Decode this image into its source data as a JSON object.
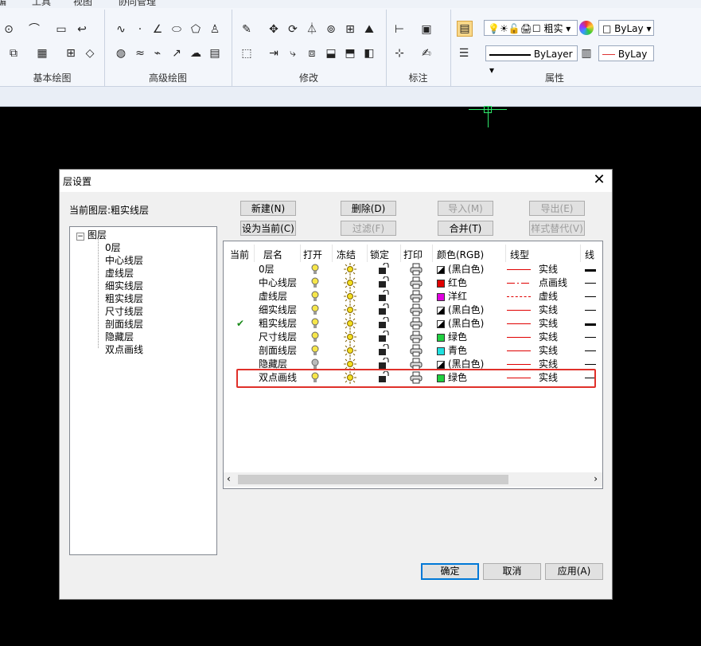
{
  "menubar": {
    "items": [
      "编",
      "工具",
      "视图",
      "协同管理"
    ]
  },
  "ribbon": {
    "groups": [
      {
        "label": "基本绘图"
      },
      {
        "label": "高级绘图"
      },
      {
        "label": "修改"
      },
      {
        "label": "标注"
      },
      {
        "label": "属性"
      }
    ],
    "properties": {
      "layer_combo": "粗实",
      "color_combo": "ByLay",
      "linetype_combo": "ByLayer",
      "lineweight_combo": "ByLay"
    }
  },
  "dialog": {
    "title": "层设置",
    "current_layer_label": "当前图层:粗实线层",
    "buttons": {
      "new": "新建(N)",
      "delete": "删除(D)",
      "import": "导入(M)",
      "export": "导出(E)",
      "set_current": "设为当前(C)",
      "filter": "过滤(F)",
      "merge": "合并(T)",
      "style_replace": "样式替代(V)",
      "ok": "确定",
      "cancel": "取消",
      "apply": "应用(A)"
    },
    "tree": {
      "root": "图层",
      "children": [
        "0层",
        "中心线层",
        "虚线层",
        "细实线层",
        "粗实线层",
        "尺寸线层",
        "剖面线层",
        "隐藏层",
        "双点画线"
      ]
    },
    "columns": [
      "当前",
      "层名",
      "打开",
      "冻结",
      "锁定",
      "打印",
      "颜色(RGB)",
      "线型",
      "线"
    ],
    "rows": [
      {
        "current": "",
        "name": "0层",
        "color_name": "(黑白色)",
        "color_hex": "bw",
        "linetype": "实线",
        "lt_style": "solid",
        "lw": "thick"
      },
      {
        "current": "",
        "name": "中心线层",
        "color_name": "红色",
        "color_hex": "#e00000",
        "linetype": "点画线",
        "lt_style": "dashdot",
        "lw": "thin"
      },
      {
        "current": "",
        "name": "虚线层",
        "color_name": "洋红",
        "color_hex": "#e000e0",
        "linetype": "虚线",
        "lt_style": "dash",
        "lw": "thin"
      },
      {
        "current": "",
        "name": "细实线层",
        "color_name": "(黑白色)",
        "color_hex": "bw",
        "linetype": "实线",
        "lt_style": "solid",
        "lw": "thin"
      },
      {
        "current": "✔",
        "name": "粗实线层",
        "color_name": "(黑白色)",
        "color_hex": "bw",
        "linetype": "实线",
        "lt_style": "solid",
        "lw": "thick"
      },
      {
        "current": "",
        "name": "尺寸线层",
        "color_name": "绿色",
        "color_hex": "#20d040",
        "linetype": "实线",
        "lt_style": "solid",
        "lw": "thin"
      },
      {
        "current": "",
        "name": "剖面线层",
        "color_name": "青色",
        "color_hex": "#20e0e0",
        "linetype": "实线",
        "lt_style": "solid",
        "lw": "thin"
      },
      {
        "current": "",
        "name": "隐藏层",
        "color_name": "(黑白色)",
        "color_hex": "bw",
        "linetype": "实线",
        "lt_style": "solid",
        "lw": "thin",
        "bulb_off": true
      },
      {
        "current": "",
        "name": "双点画线",
        "color_name": "绿色",
        "color_hex": "#20d040",
        "linetype": "实线",
        "lt_style": "solid",
        "lw": "thin"
      }
    ],
    "accent": {
      "highlight": "#e0302a",
      "current_check": "#1a8a1a",
      "linetype_red": "#e00000"
    }
  }
}
